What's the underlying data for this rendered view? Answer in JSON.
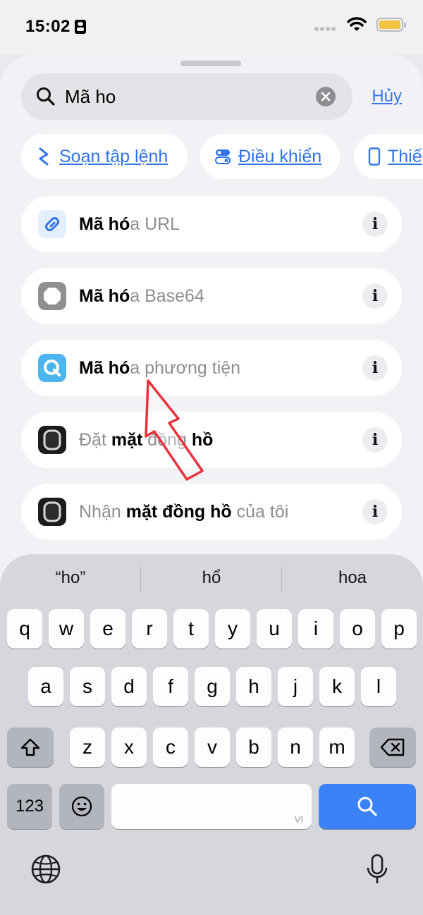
{
  "status_bar": {
    "time": "15:02"
  },
  "search": {
    "value": "Mã ho",
    "cancel_label": "Hủy"
  },
  "chips": [
    {
      "label": "Soạn tập lệnh",
      "icon": "script-icon"
    },
    {
      "label": "Điều khiển",
      "icon": "toggle-controls-icon"
    },
    {
      "label": "Thiế",
      "icon": "phone-device-icon"
    }
  ],
  "results": [
    {
      "match": "Mã hó",
      "rest": "a URL",
      "icon": "link-icon"
    },
    {
      "match": "Mã hó",
      "rest": "a Base64",
      "icon": "octagon-icon"
    },
    {
      "match": "Mã hó",
      "rest": "a phương tiện",
      "icon": "quicktime-icon"
    },
    {
      "parts": [
        {
          "t": "Đặt ",
          "hl": false
        },
        {
          "t": "mặt",
          "hl": true
        },
        {
          "t": " đồng ",
          "hl": false
        },
        {
          "t": "hồ",
          "hl": true
        }
      ],
      "icon": "watch-icon"
    },
    {
      "parts": [
        {
          "t": "Nhận ",
          "hl": false
        },
        {
          "t": "mặt đồng hồ",
          "hl": true
        },
        {
          "t": " của tôi",
          "hl": false
        }
      ],
      "icon": "watch-icon"
    }
  ],
  "info_label": "i",
  "keyboard": {
    "predictions": [
      "“ho”",
      "hổ",
      "hoa"
    ],
    "row1": [
      "q",
      "w",
      "e",
      "r",
      "t",
      "y",
      "u",
      "i",
      "o",
      "p"
    ],
    "row2": [
      "a",
      "s",
      "d",
      "f",
      "g",
      "h",
      "j",
      "k",
      "l"
    ],
    "row3": [
      "z",
      "x",
      "c",
      "v",
      "b",
      "n",
      "m"
    ],
    "numbers_label": "123",
    "space_lang": "VI"
  },
  "colors": {
    "accent": "#3478f6",
    "search_key": "#3b82f6"
  }
}
